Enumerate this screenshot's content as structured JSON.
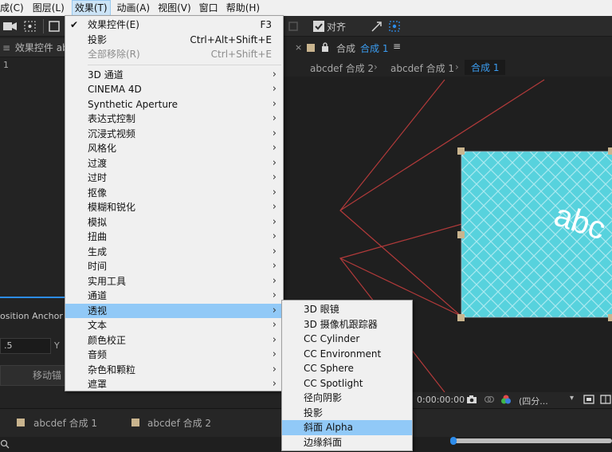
{
  "menubar": {
    "items": [
      "成(C)",
      "图层(L)",
      "效果(T)",
      "动画(A)",
      "视图(V)",
      "窗口",
      "帮助(H)"
    ]
  },
  "toolbar": {
    "align_label": "对齐"
  },
  "left_panel": {
    "tab_label": "效果控件 ab",
    "sub_label": "1",
    "position_anchor": "osition Anchor po",
    "value": ".5",
    "y_label": "Y",
    "move_button": "移动锚"
  },
  "comp_panel": {
    "header_prefix": "合成",
    "header_name": "合成 1",
    "breadcrumbs": [
      "abcdef 合成 2",
      "abcdef 合成 1",
      "合成 1"
    ],
    "timecode": "0:00:00:00",
    "zoom_select": "(四分..."
  },
  "timeline": {
    "tabs": [
      "abcdef 合成 1",
      "abcdef 合成 2"
    ]
  },
  "effects_menu": {
    "top_items": [
      {
        "label": "效果控件(E)",
        "shortcut": "F3",
        "checked": true,
        "disabled": false
      },
      {
        "label": "投影",
        "shortcut": "Ctrl+Alt+Shift+E",
        "checked": false,
        "disabled": false
      },
      {
        "label": "全部移除(R)",
        "shortcut": "Ctrl+Shift+E",
        "checked": false,
        "disabled": true
      }
    ],
    "categories": [
      "3D 通道",
      "CINEMA 4D",
      "Synthetic Aperture",
      "表达式控制",
      "沉浸式视频",
      "风格化",
      "过渡",
      "过时",
      "抠像",
      "模糊和锐化",
      "模拟",
      "扭曲",
      "生成",
      "时间",
      "实用工具",
      "通道",
      "透视",
      "文本",
      "颜色校正",
      "音频",
      "杂色和颗粒",
      "遮罩"
    ],
    "highlighted_category": "透视"
  },
  "perspective_submenu": {
    "items": [
      "3D 眼镜",
      "3D 摄像机跟踪器",
      "CC Cylinder",
      "CC Environment",
      "CC Sphere",
      "CC Spotlight",
      "径向阴影",
      "投影",
      "斜面 Alpha",
      "边缘斜面"
    ],
    "highlighted_item": "斜面 Alpha"
  },
  "canvas_text": "abc",
  "colors": {
    "menu_bg": "#f0f0f0",
    "menu_highlight": "#91c9f7",
    "accent_blue": "#2d8ceb",
    "canvas_cyan": "#57d2dd",
    "guide_red": "#b23a3a",
    "handle": "#c9b48e"
  }
}
